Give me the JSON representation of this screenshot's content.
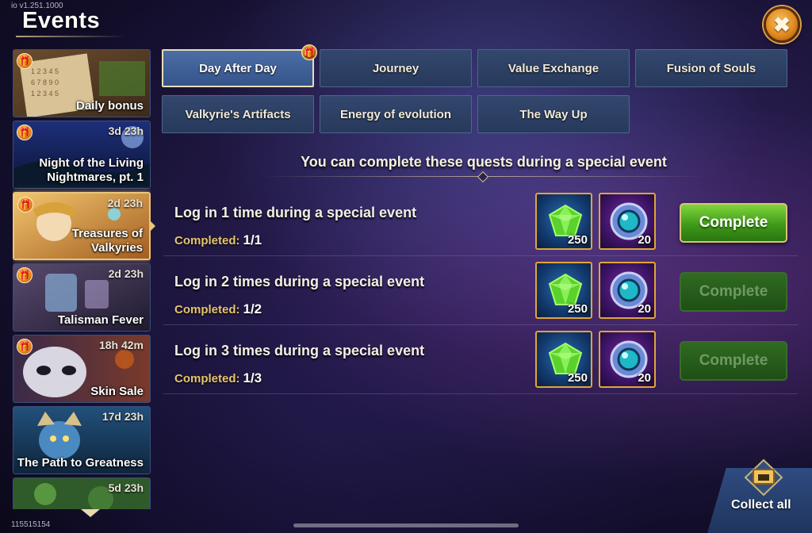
{
  "version": "io v1.251.1000",
  "player_id": "115515154",
  "header": {
    "title": "Events",
    "close_icon": "close-icon"
  },
  "sidebar": {
    "events": [
      {
        "name": "Daily bonus",
        "timer": "",
        "gift": true
      },
      {
        "name": "Night of the Living Nightmares, pt. 1",
        "line1": "Night of the Living",
        "line2": "Nightmares, pt. 1",
        "timer": "3d 23h",
        "gift": true
      },
      {
        "name": "Treasures of Valkyries",
        "line1": "Treasures of",
        "line2": "Valkyries",
        "timer": "2d 23h",
        "gift": true,
        "active": true
      },
      {
        "name": "Talisman Fever",
        "timer": "2d 23h",
        "gift": true
      },
      {
        "name": "Skin Sale",
        "timer": "18h 42m",
        "gift": true
      },
      {
        "name": "The Path to Greatness",
        "timer": "17d 23h",
        "gift": false
      },
      {
        "name": "",
        "timer": "5d 23h",
        "gift": false
      }
    ]
  },
  "tabs": [
    {
      "label": "Day After Day",
      "active": true,
      "gift": true
    },
    {
      "label": "Journey"
    },
    {
      "label": "Value Exchange"
    },
    {
      "label": "Fusion of Souls"
    },
    {
      "label": "Valkyrie's Artifacts"
    },
    {
      "label": "Energy of evolution"
    },
    {
      "label": "The Way Up"
    }
  ],
  "subtitle": "You can complete these quests during a special event",
  "quests": [
    {
      "title": "Log in 1 time during a special event",
      "progress_label": "Completed:",
      "progress_value": "1/1",
      "rewards": [
        {
          "icon": "emerald-icon",
          "qty": "250"
        },
        {
          "icon": "artifact-orb-icon",
          "qty": "20"
        }
      ],
      "button": "Complete",
      "enabled": true
    },
    {
      "title": "Log in 2 times during a special event",
      "progress_label": "Completed:",
      "progress_value": "1/2",
      "rewards": [
        {
          "icon": "emerald-icon",
          "qty": "250"
        },
        {
          "icon": "artifact-orb-icon",
          "qty": "20"
        }
      ],
      "button": "Complete",
      "enabled": false
    },
    {
      "title": "Log in 3 times during a special event",
      "progress_label": "Completed:",
      "progress_value": "1/3",
      "rewards": [
        {
          "icon": "emerald-icon",
          "qty": "250"
        },
        {
          "icon": "artifact-orb-icon",
          "qty": "20"
        }
      ],
      "button": "Complete",
      "enabled": false
    }
  ],
  "collect_all": {
    "label": "Collect all"
  },
  "colors": {
    "accent_gold": "#e0a53a",
    "button_green": "#3f9a1a",
    "tab_blue": "#273a5c"
  }
}
